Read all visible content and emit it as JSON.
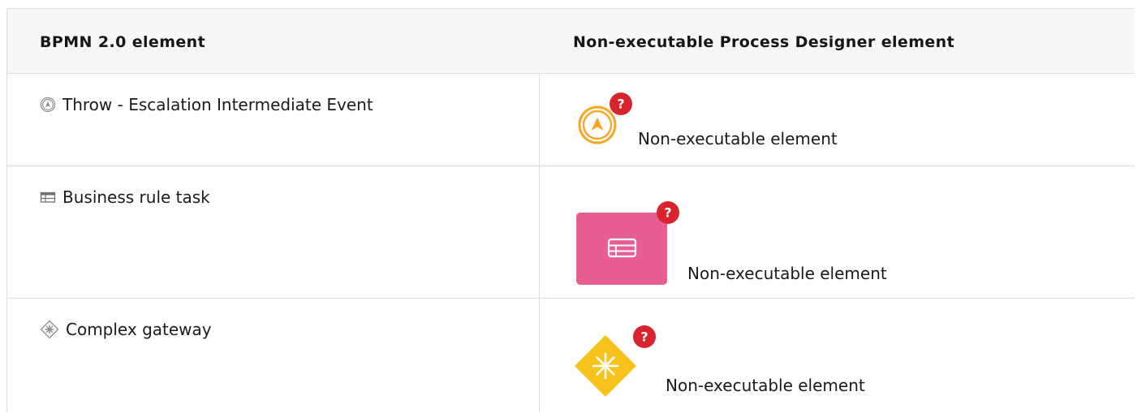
{
  "table": {
    "headers": {
      "col1": "BPMN 2.0 element",
      "col2": "Non-executable Process Designer element"
    },
    "rows": [
      {
        "bpmn_label": "Throw - Escalation Intermediate Event",
        "bpmn_icon": "escalation-event-icon",
        "designer_icon": "escalation-event-non-executable-icon",
        "designer_label": "Non-executable element",
        "badge": "?"
      },
      {
        "bpmn_label": "Business rule task",
        "bpmn_icon": "business-rule-task-icon",
        "designer_icon": "business-rule-task-non-executable-icon",
        "designer_label": "Non-executable element",
        "badge": "?"
      },
      {
        "bpmn_label": "Complex gateway",
        "bpmn_icon": "complex-gateway-icon",
        "designer_icon": "complex-gateway-non-executable-icon",
        "designer_label": "Non-executable element",
        "badge": "?"
      }
    ]
  },
  "colors": {
    "escalation": "#f5a623",
    "business_rule_task": "#e75e90",
    "complex_gateway": "#f7c21b",
    "badge": "#d9232e",
    "grid_line": "#dcdcdc",
    "header_bg": "#f7f7f7"
  }
}
